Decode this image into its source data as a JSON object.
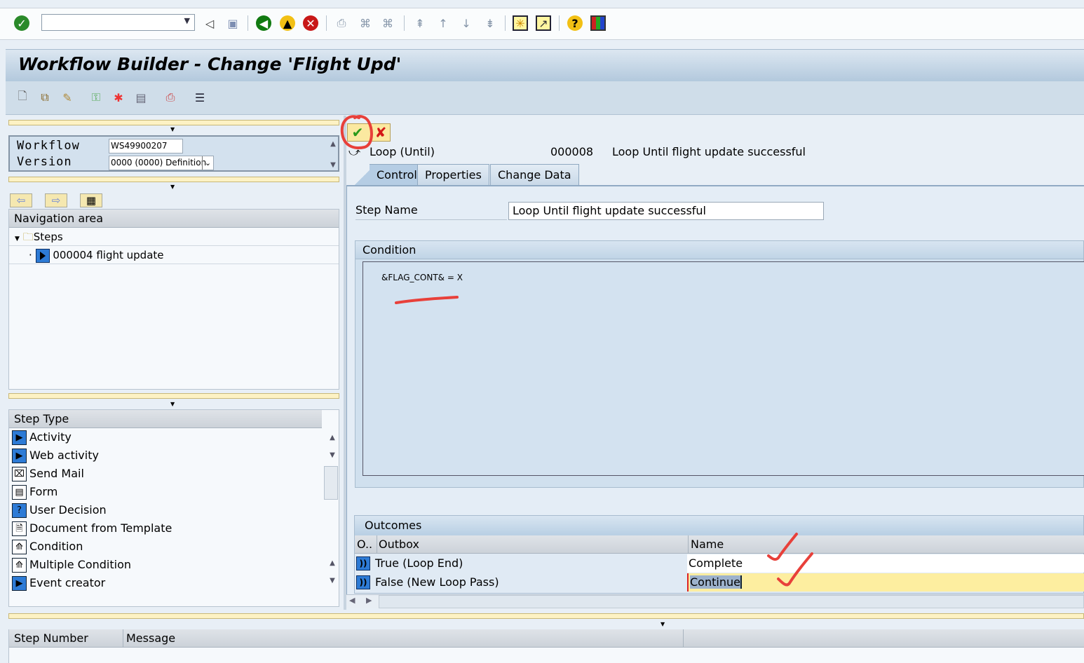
{
  "system_toolbar": {
    "command_field": "",
    "icons": [
      "enter-icon",
      "back-icon",
      "save-icon",
      "back-green-icon",
      "exit-icon",
      "cancel-icon",
      "print-icon",
      "find-icon",
      "find-next-icon",
      "first-page-icon",
      "previous-page-icon",
      "next-page-icon",
      "last-page-icon",
      "create-session-icon",
      "shortcut-icon",
      "help-icon",
      "customize-layout-icon"
    ]
  },
  "title": "Workflow Builder - Change 'Flight Upd'",
  "app_toolbar": {
    "icons": [
      "new-icon",
      "copy-icon",
      "edit-icon",
      "connect-icon",
      "activate-icon",
      "test-icon",
      "print-icon",
      "list-icon"
    ]
  },
  "header_form": {
    "workflow_label": "Workflow",
    "workflow_value": "WS49900207",
    "version_label": "Version",
    "version_value": "0000 (0000) Definition"
  },
  "navigation": {
    "title": "Navigation area",
    "root": "Steps",
    "items": [
      "000004 flight update"
    ]
  },
  "step_types": {
    "header": "Step Type",
    "items": [
      "Activity",
      "Web activity",
      "Send Mail",
      "Form",
      "User Decision",
      "Document from Template",
      "Condition",
      "Multiple Condition",
      "Event creator"
    ]
  },
  "step_detail": {
    "type": "Loop (Until)",
    "number": "000008",
    "description": "Loop Until flight update successful",
    "tabs": [
      "Control",
      "Properties",
      "Change Data"
    ],
    "active_tab": "Control",
    "step_name_label": "Step Name",
    "step_name_value": "Loop Until flight update successful",
    "condition_title": "Condition",
    "condition_text": "&FLAG_CONT& = X"
  },
  "outcomes": {
    "title": "Outcomes",
    "columns": [
      "O..",
      "Outbox",
      "Name"
    ],
    "rows": [
      {
        "outbox": "True (Loop End)",
        "name": "Complete"
      },
      {
        "outbox": "False (New Loop Pass)",
        "name": "Continue"
      }
    ]
  },
  "messages": {
    "columns": [
      "Step Number",
      "Message"
    ]
  },
  "colors": {
    "annotation": "#e8403a",
    "selected_row": "#fdeea0",
    "title_gradient": "#b3c9dd"
  }
}
